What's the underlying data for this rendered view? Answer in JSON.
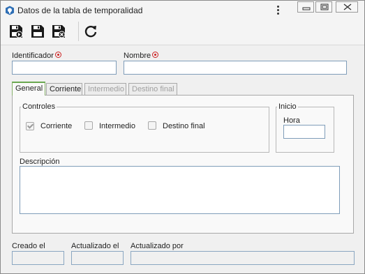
{
  "window": {
    "title": "Datos de la tabla de temporalidad",
    "menu_icon": "kebab-icon",
    "controls": [
      "minimize-icon",
      "maximize-icon",
      "close-icon"
    ]
  },
  "toolbar": {
    "buttons": [
      {
        "name": "save-and-new-icon"
      },
      {
        "name": "save-icon"
      },
      {
        "name": "save-and-close-icon"
      },
      {
        "name": "refresh-icon"
      }
    ]
  },
  "form": {
    "identificador_label": "Identificador",
    "identificador_value": "",
    "nombre_label": "Nombre",
    "nombre_value": "",
    "required_color": "#cc2222"
  },
  "tabs": [
    {
      "label": "General",
      "active": true,
      "enabled": true
    },
    {
      "label": "Corriente",
      "active": false,
      "enabled": true
    },
    {
      "label": "Intermedio",
      "active": false,
      "enabled": false
    },
    {
      "label": "Destino final",
      "active": false,
      "enabled": false
    }
  ],
  "general": {
    "controles_legend": "Controles",
    "controles": [
      {
        "label": "Corriente",
        "checked": true,
        "enabled": false
      },
      {
        "label": "Intermedio",
        "checked": false,
        "enabled": true
      },
      {
        "label": "Destino final",
        "checked": false,
        "enabled": true
      }
    ],
    "inicio_legend": "Inicio",
    "hora_label": "Hora",
    "hora_value": "",
    "descripcion_label": "Descripción",
    "descripcion_value": ""
  },
  "footer": {
    "creado_label": "Creado el",
    "creado_value": "",
    "actualizado_label": "Actualizado el",
    "actualizado_value": "",
    "actualizado_por_label": "Actualizado por",
    "actualizado_por_value": ""
  },
  "colors": {
    "active_tab_accent": "#6aa84f",
    "input_border": "#7f9db9",
    "toolbar_icon": "#1a1a1a"
  }
}
